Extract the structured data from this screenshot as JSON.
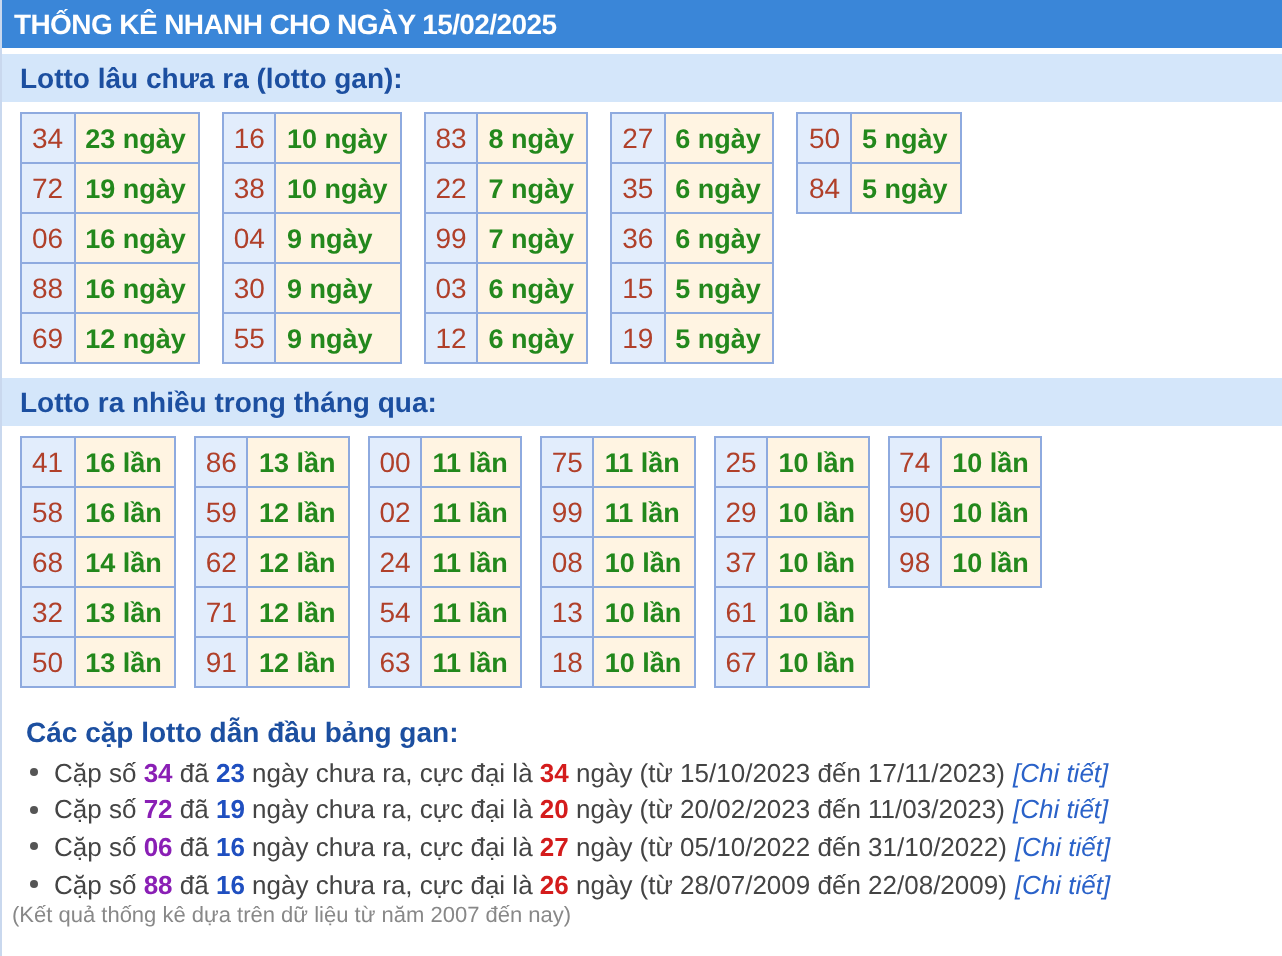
{
  "title": "THỐNG KÊ NHANH CHO NGÀY 15/02/2025",
  "sections": [
    {
      "heading": "Lotto lâu chưa ra (lotto gan):",
      "groups": [
        [
          [
            "34",
            "23 ngày"
          ],
          [
            "72",
            "19 ngày"
          ],
          [
            "06",
            "16 ngày"
          ],
          [
            "88",
            "16 ngày"
          ],
          [
            "69",
            "12 ngày"
          ]
        ],
        [
          [
            "16",
            "10 ngày"
          ],
          [
            "38",
            "10 ngày"
          ],
          [
            "04",
            "9 ngày"
          ],
          [
            "30",
            "9 ngày"
          ],
          [
            "55",
            "9 ngày"
          ]
        ],
        [
          [
            "83",
            "8 ngày"
          ],
          [
            "22",
            "7 ngày"
          ],
          [
            "99",
            "7 ngày"
          ],
          [
            "03",
            "6 ngày"
          ],
          [
            "12",
            "6 ngày"
          ]
        ],
        [
          [
            "27",
            "6 ngày"
          ],
          [
            "35",
            "6 ngày"
          ],
          [
            "36",
            "6 ngày"
          ],
          [
            "15",
            "5 ngày"
          ],
          [
            "19",
            "5 ngày"
          ]
        ],
        [
          [
            "50",
            "5 ngày"
          ],
          [
            "84",
            "5 ngày"
          ]
        ]
      ]
    },
    {
      "heading": "Lotto ra nhiều trong tháng qua:",
      "groups": [
        [
          [
            "41",
            "16 lần"
          ],
          [
            "58",
            "16 lần"
          ],
          [
            "68",
            "14 lần"
          ],
          [
            "32",
            "13 lần"
          ],
          [
            "50",
            "13 lần"
          ]
        ],
        [
          [
            "86",
            "13 lần"
          ],
          [
            "59",
            "12 lần"
          ],
          [
            "62",
            "12 lần"
          ],
          [
            "71",
            "12 lần"
          ],
          [
            "91",
            "12 lần"
          ]
        ],
        [
          [
            "00",
            "11 lần"
          ],
          [
            "02",
            "11 lần"
          ],
          [
            "24",
            "11 lần"
          ],
          [
            "54",
            "11 lần"
          ],
          [
            "63",
            "11 lần"
          ]
        ],
        [
          [
            "75",
            "11 lần"
          ],
          [
            "99",
            "11 lần"
          ],
          [
            "08",
            "10 lần"
          ],
          [
            "13",
            "10 lần"
          ],
          [
            "18",
            "10 lần"
          ]
        ],
        [
          [
            "25",
            "10 lần"
          ],
          [
            "29",
            "10 lần"
          ],
          [
            "37",
            "10 lần"
          ],
          [
            "61",
            "10 lần"
          ],
          [
            "67",
            "10 lần"
          ]
        ],
        [
          [
            "74",
            "10 lần"
          ],
          [
            "90",
            "10 lần"
          ],
          [
            "98",
            "10 lần"
          ]
        ]
      ]
    }
  ],
  "summary": {
    "heading": "Các cặp lotto dẫn đầu bảng gan:",
    "items": [
      {
        "parts": [
          {
            "kind": "plain",
            "text": "Cặp số "
          },
          {
            "kind": "pair",
            "text": "34"
          },
          {
            "kind": "plain",
            "text": " đã "
          },
          {
            "kind": "days",
            "text": "23"
          },
          {
            "kind": "plain",
            "text": " ngày chưa ra, cực đại là "
          },
          {
            "kind": "max",
            "text": "34"
          },
          {
            "kind": "plain",
            "text": " ngày (từ 15/10/2023 đến 17/11/2023)"
          }
        ],
        "link": "[Chi tiết]"
      },
      {
        "parts": [
          {
            "kind": "plain",
            "text": "Cặp số "
          },
          {
            "kind": "pair",
            "text": "72"
          },
          {
            "kind": "plain",
            "text": " đã "
          },
          {
            "kind": "days",
            "text": "19"
          },
          {
            "kind": "plain",
            "text": " ngày chưa ra, cực đại là "
          },
          {
            "kind": "max",
            "text": "20"
          },
          {
            "kind": "plain",
            "text": " ngày (từ 20/02/2023 đến 11/03/2023)"
          }
        ],
        "link": "[Chi tiết]"
      },
      {
        "parts": [
          {
            "kind": "plain",
            "text": "Cặp số "
          },
          {
            "kind": "pair",
            "text": "06"
          },
          {
            "kind": "plain",
            "text": " đã "
          },
          {
            "kind": "days",
            "text": "16"
          },
          {
            "kind": "plain",
            "text": " ngày chưa ra, cực đại là "
          },
          {
            "kind": "max",
            "text": "27"
          },
          {
            "kind": "plain",
            "text": " ngày (từ 05/10/2022 đến 31/10/2022)"
          }
        ],
        "link": "[Chi tiết]"
      },
      {
        "parts": [
          {
            "kind": "plain",
            "text": "Cặp số "
          },
          {
            "kind": "pair",
            "text": "88"
          },
          {
            "kind": "plain",
            "text": " đã "
          },
          {
            "kind": "days",
            "text": "16"
          },
          {
            "kind": "plain",
            "text": " ngày chưa ra, cực đại là "
          },
          {
            "kind": "max",
            "text": "26"
          },
          {
            "kind": "plain",
            "text": " ngày (từ 28/07/2009 đến 22/08/2009)"
          }
        ],
        "link": "[Chi tiết]"
      }
    ],
    "note": "(Kết quả thống kê dựa trên dữ liệu từ năm 2007 đến nay)"
  }
}
